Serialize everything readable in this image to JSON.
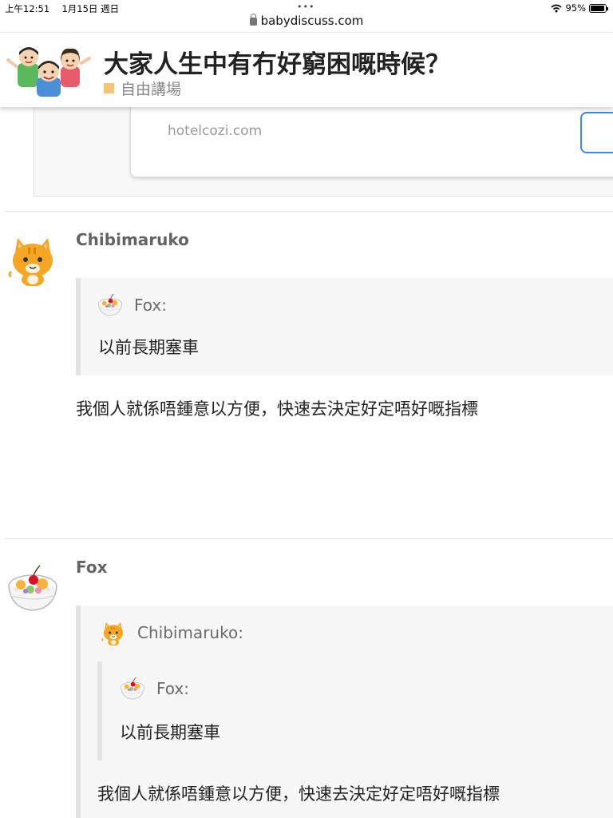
{
  "status_bar": {
    "time": "上午12:51",
    "date": "1月15日 週日",
    "dots": "•••",
    "battery_percent": "95%",
    "battery_level": 0.95
  },
  "browser": {
    "url": "babydiscuss.com"
  },
  "topic": {
    "title": "大家人生中有冇好窮困嘅時候？",
    "category": "自由講場",
    "category_color": "#f5c577"
  },
  "onebox": {
    "domain": "hotelcozi.com"
  },
  "posts": [
    {
      "username": "Chibimaruko",
      "avatar_icon": "orange-cat-avatar",
      "quote": {
        "author": "Fox:",
        "author_icon": "dessert-bowl-avatar",
        "text": "以前長期塞車"
      },
      "body": "我個人就係唔鍾意以方便，快速去決定好定唔好嘅指標"
    },
    {
      "username": "Fox",
      "avatar_icon": "dessert-bowl-avatar",
      "quote": {
        "author": "Chibimaruko:",
        "author_icon": "orange-cat-avatar",
        "nested_quote": {
          "author": "Fox:",
          "author_icon": "dessert-bowl-avatar",
          "text": "以前長期塞車"
        },
        "text": "我個人就係唔鍾意以方便，快速去決定好定唔好嘅指標"
      }
    }
  ]
}
